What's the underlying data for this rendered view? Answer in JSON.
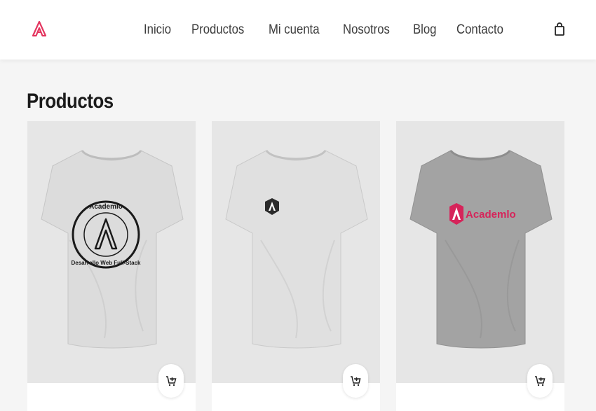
{
  "header": {
    "brand_icon": "academlo-logo",
    "brand_color": "#e4355f",
    "nav": [
      "Inicio",
      "Productos",
      "Mi cuenta",
      "Nosotros",
      "Blog",
      "Contacto"
    ],
    "cart_icon": "shopping-bag-icon"
  },
  "main": {
    "title": "Productos",
    "products": [
      {
        "shirt_color": "#dcdcdc",
        "print": "round-badge",
        "print_top_text": "Academlo",
        "print_bottom_text": "Desarrollo Web Full-Stack",
        "add_icon": "add-to-cart-icon"
      },
      {
        "shirt_color": "#e0e0e0",
        "print": "small-hex-logo",
        "add_icon": "add-to-cart-icon"
      },
      {
        "shirt_color": "#a3a3a3",
        "print": "academlo-wordmark",
        "print_text": "Academlo",
        "print_color": "#d6245a",
        "add_icon": "add-to-cart-icon"
      }
    ]
  }
}
